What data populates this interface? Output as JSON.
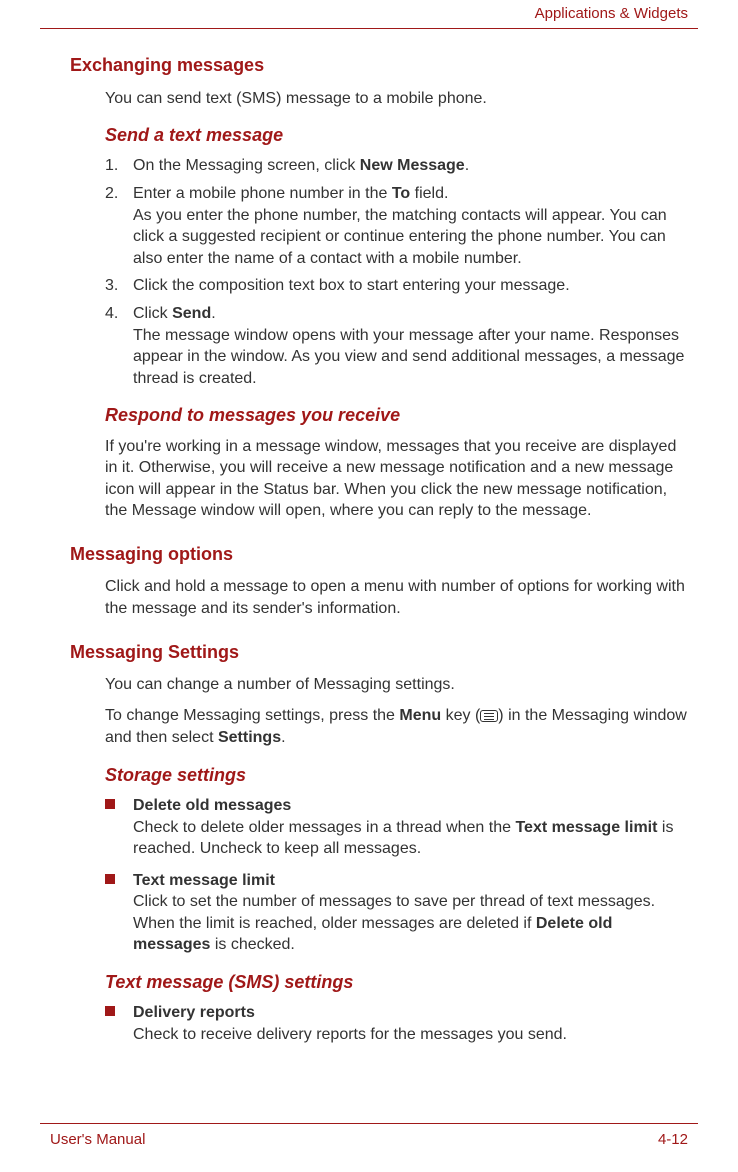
{
  "header": {
    "section_title": "Applications & Widgets"
  },
  "sections": {
    "exchanging": {
      "heading": "Exchanging messages",
      "intro": "You can send text (SMS) message to a mobile phone.",
      "send": {
        "heading": "Send a text message",
        "step1_pre": "On the Messaging screen, click ",
        "step1_bold": "New Message",
        "step1_post": ".",
        "step2_pre": "Enter a mobile phone number in the ",
        "step2_bold": "To",
        "step2_post": " field.",
        "step2_detail": "As you enter the phone number, the matching contacts will appear. You can click a suggested recipient or continue entering the phone number. You can also enter the name of a contact with a mobile number.",
        "step3": "Click the composition text box to start entering your message.",
        "step4_pre": "Click ",
        "step4_bold": "Send",
        "step4_post": ".",
        "step4_detail": "The message window opens with your message after your name. Responses appear in the window. As you view and send additional messages, a message thread is created."
      },
      "respond": {
        "heading": "Respond to messages you receive",
        "body": "If you're working in a message window, messages that you receive are displayed in it. Otherwise, you will receive a new message notification and a new message icon will appear in the Status bar. When you click the new message notification, the Message window will open, where you can reply to the message."
      }
    },
    "options": {
      "heading": "Messaging options",
      "body": "Click and hold a message to open a menu with number of options for working with the message and its sender's information."
    },
    "settings": {
      "heading": "Messaging Settings",
      "intro": "You can change a number of Messaging settings.",
      "instr_pre": "To change Messaging settings, press the ",
      "instr_bold1": "Menu",
      "instr_mid": " key (",
      "instr_post": ") in the Messaging window and then select ",
      "instr_bold2": "Settings",
      "instr_end": ".",
      "storage": {
        "heading": "Storage settings",
        "item1_title": "Delete old messages",
        "item1_body_pre": "Check to delete older messages in a thread when the ",
        "item1_body_bold": "Text message limit",
        "item1_body_post": " is reached. Uncheck to keep all messages.",
        "item2_title": "Text message limit",
        "item2_body_pre": "Click to set the number of messages to save per thread of text messages. When the limit is reached, older messages are deleted if ",
        "item2_body_bold": "Delete old messages",
        "item2_body_post": " is checked."
      },
      "sms": {
        "heading": "Text message (SMS) settings",
        "item1_title": "Delivery reports",
        "item1_body": "Check to receive delivery reports for the messages you send."
      }
    }
  },
  "footer": {
    "manual": "User's Manual",
    "page": "4-12"
  }
}
